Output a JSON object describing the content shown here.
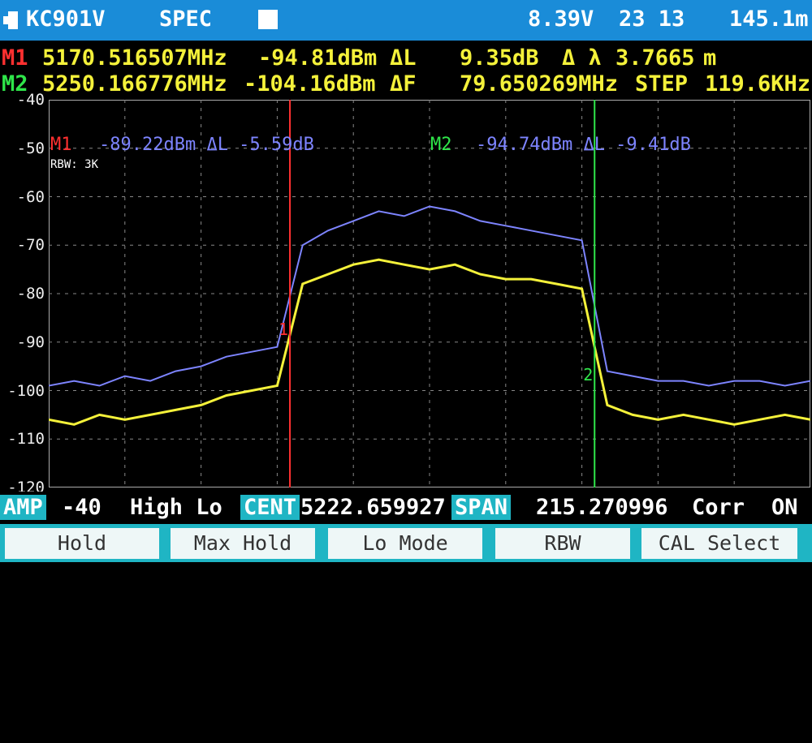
{
  "header": {
    "device": "KC901V",
    "mode": "SPEC",
    "voltage": "8.39V",
    "time": "23 13",
    "value": "145.1m"
  },
  "marker1": {
    "label": "M1",
    "freq": "5170.516507MHz",
    "level": "-94.81dBm",
    "delta_label": "ΔL",
    "delta_value": "9.35dB",
    "lambda_label": "Δ λ",
    "lambda_value": "3.7665",
    "lambda_unit": "m"
  },
  "marker2": {
    "label": "M2",
    "freq": "5250.166776MHz",
    "level": "-104.16dBm",
    "delta_label": "ΔF",
    "delta_value": "79.650269MHz",
    "step_label": "STEP",
    "step_value": "119.6KHz"
  },
  "overlay": {
    "m1_label": "M1",
    "m1_text": "-89.22dBm ΔL -5.59dB",
    "m2_label": "M2",
    "m2_text": "-94.74dBm ΔL -9.41dB",
    "rbw": "RBW: 3K",
    "marker1_num": "1",
    "marker2_num": "2"
  },
  "chart_data": {
    "type": "line",
    "ylim": [
      -120,
      -40
    ],
    "yticks": [
      "-40",
      "-50",
      "-60",
      "-70",
      "-80",
      "-90",
      "-100",
      "-110",
      "-120"
    ],
    "grid": true,
    "series": [
      {
        "color": "#7d84ff",
        "values": [
          -99,
          -98,
          -99,
          -97,
          -98,
          -96,
          -95,
          -93,
          -92,
          -91,
          -70,
          -67,
          -65,
          -63,
          -64,
          -62,
          -63,
          -65,
          -66,
          -67,
          -68,
          -69,
          -96,
          -97,
          -98,
          -98,
          -99,
          -98,
          -98,
          -99,
          -98
        ]
      },
      {
        "color": "#f4f13a",
        "values": [
          -106,
          -107,
          -105,
          -106,
          -105,
          -104,
          -103,
          -101,
          -100,
          -99,
          -78,
          -76,
          -74,
          -73,
          -74,
          -75,
          -74,
          -76,
          -77,
          -77,
          -78,
          -79,
          -103,
          -105,
          -106,
          -105,
          -106,
          -107,
          -106,
          -105,
          -106
        ]
      }
    ],
    "markers": [
      {
        "label": "1",
        "x_index": 9.5,
        "color": "#ff3030"
      },
      {
        "label": "2",
        "x_index": 21.5,
        "color": "#2fe64a"
      }
    ]
  },
  "status": {
    "amp_tag": "AMP",
    "amp_value": "-40",
    "lo_mode": "High Lo",
    "cent_tag": "CENT",
    "cent_value": "5222.659927",
    "span_tag": "SPAN",
    "span_value": "215.270996",
    "corr_label": "Corr",
    "corr_value": "ON"
  },
  "softkeys": [
    "Hold",
    "Max Hold",
    "Lo Mode",
    "RBW",
    "CAL Select"
  ]
}
